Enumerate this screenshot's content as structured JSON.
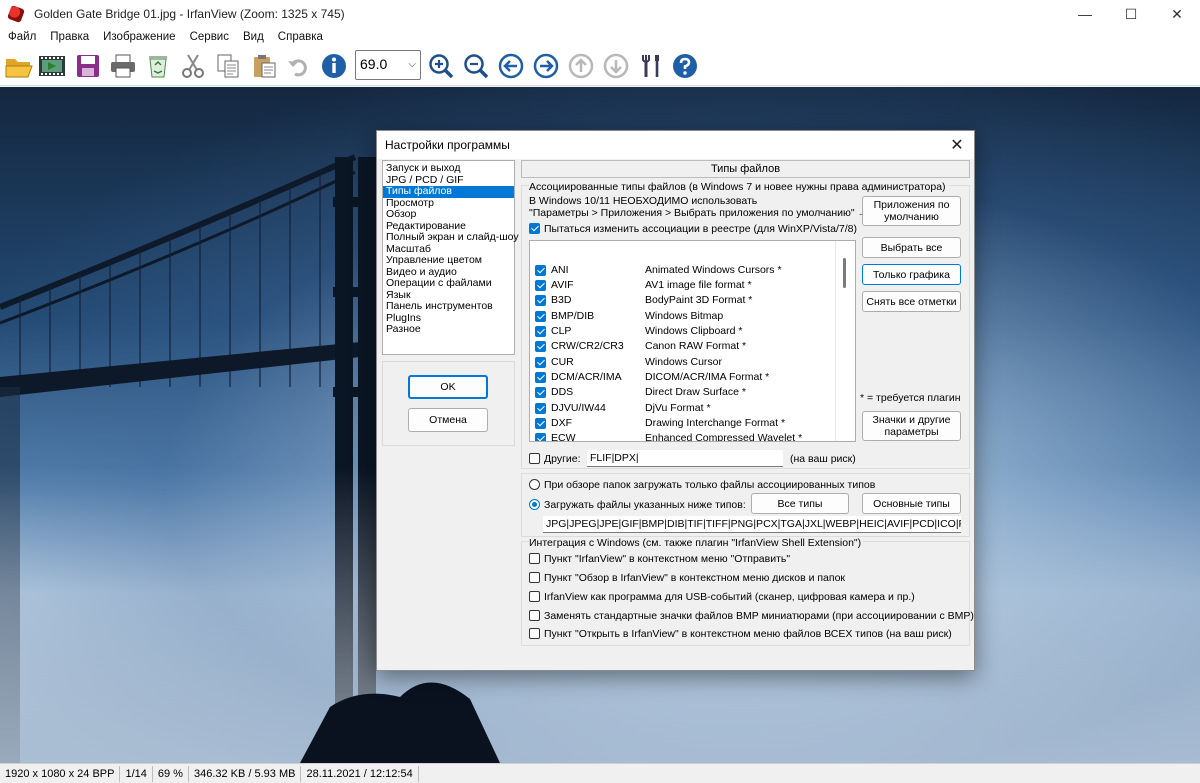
{
  "window": {
    "title": "Golden Gate Bridge 01.jpg - IrfanView (Zoom: 1325 x 745)",
    "minimize": "—",
    "maximize": "☐",
    "close": "✕"
  },
  "menu": [
    "Файл",
    "Правка",
    "Изображение",
    "Сервис",
    "Вид",
    "Справка"
  ],
  "toolbar": {
    "zoom_value": "69.0",
    "zoom_arrow": "⌵"
  },
  "statusbar": [
    "1920 x 1080 x 24 BPP",
    "1/14",
    "69 %",
    "346.32 KB / 5.93 MB",
    "28.11.2021 / 12:12:54"
  ],
  "dialog": {
    "title": "Настройки программы",
    "close": "✕",
    "categories": [
      "Запуск и выход",
      "JPG / PCD / GIF",
      "Типы файлов",
      "Просмотр",
      "Обзор",
      "Редактирование",
      "Полный экран и слайд-шоу",
      "Масштаб",
      "Управление цветом",
      "Видео и аудио",
      "Операции с файлами",
      "Язык",
      "Панель инструментов",
      "PlugIns",
      "Разное"
    ],
    "selected_category": "Типы файлов",
    "ok": "OK",
    "cancel": "Отмена",
    "section_title": "Типы файлов",
    "assoc_header": "Ассоциированные типы файлов (в Windows 7 и новее нужны права администратора)",
    "win10_note_1": "В Windows 10/11 НЕОБХОДИМО использовать",
    "win10_note_2": "\"Параметры > Приложения > Выбрать приложения по умолчанию\" →",
    "registry_check": "Пытаться изменить ассоциации в реестре (для WinXP/Vista/7/8)",
    "btn_default_apps": "Приложения по умолчанию",
    "btn_select_all": "Выбрать все",
    "btn_graphics_only": "Только графика",
    "btn_clear_all": "Снять все отметки",
    "plugin_note": "* = требуется плагин",
    "btn_icons": "Значки и другие параметры",
    "file_types": [
      {
        "ext": "ANI",
        "desc": "Animated Windows Cursors *"
      },
      {
        "ext": "AVIF",
        "desc": "AV1 image file format *"
      },
      {
        "ext": "B3D",
        "desc": "BodyPaint 3D Format *"
      },
      {
        "ext": "BMP/DIB",
        "desc": "Windows Bitmap"
      },
      {
        "ext": "CLP",
        "desc": "Windows Clipboard *"
      },
      {
        "ext": "CRW/CR2/CR3",
        "desc": "Canon RAW Format *"
      },
      {
        "ext": "CUR",
        "desc": "Windows Cursor"
      },
      {
        "ext": "DCM/ACR/IMA",
        "desc": "DICOM/ACR/IMA Format *"
      },
      {
        "ext": "DDS",
        "desc": "Direct Draw Surface *"
      },
      {
        "ext": "DJVU/IW44",
        "desc": "DjVu Format *"
      },
      {
        "ext": "DXF",
        "desc": "Drawing Interchange Format *"
      },
      {
        "ext": "ECW",
        "desc": "Enhanced Compressed Wavelet *"
      }
    ],
    "others_label": "Другие:",
    "others_value": "FLIF|DPX|",
    "others_risk": "(на ваш риск)",
    "radio_browse_assoc": "При обзоре папок загружать только файлы ассоциированных типов",
    "radio_load_listed": "Загружать файлы указанных ниже типов:",
    "btn_all_types": "Все типы",
    "btn_main_types": "Основные типы",
    "types_value": "JPG|JPEG|JPE|GIF|BMP|DIB|TIF|TIFF|PNG|PCX|TGA|JXL|WEBP|HEIC|AVIF|PCD|ICO|PPM|PGM|P",
    "integration_header": "Интеграция с Windows (см. также плагин \"IrfanView Shell Extension\")",
    "integration": [
      "Пункт \"IrfanView\" в контекстном меню \"Отправить\"",
      "Пункт \"Обзор в IrfanView\" в контекстном меню дисков и папок",
      "IrfanView как программа для USB-событий (сканер, цифровая камера и пр.)",
      "Заменять стандартные значки файлов BMP миниатюрами (при ассоциировании с BMP)",
      "Пункт \"Открыть в IrfanView\" в контекстном меню файлов ВСЕХ типов (на ваш риск)"
    ]
  },
  "colors": {
    "accent": "#0078d7"
  }
}
